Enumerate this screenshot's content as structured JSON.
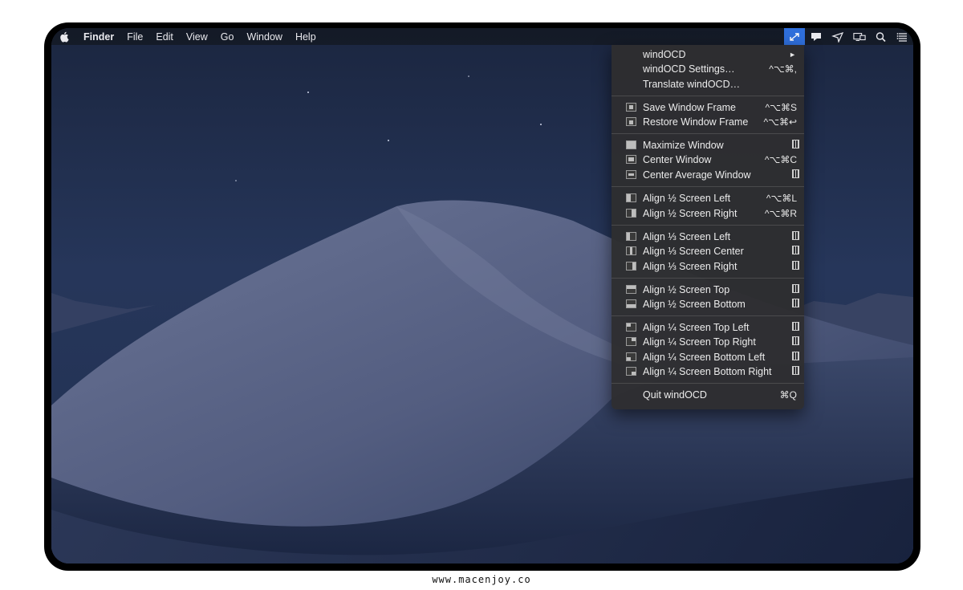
{
  "menubar": {
    "app_name": "Finder",
    "items": [
      "File",
      "Edit",
      "View",
      "Go",
      "Window",
      "Help"
    ],
    "status_icons": [
      "windocd-icon",
      "notification-icon",
      "send-icon",
      "display-icon",
      "search-icon",
      "list-icon"
    ]
  },
  "dropdown": {
    "items": [
      {
        "label": "windOCD",
        "shortcut": "►"
      },
      {
        "label": "windOCD Settings…",
        "shortcut": "^⌥⌘,"
      },
      {
        "label": "Translate windOCD…",
        "shortcut": ""
      },
      {
        "label": "Save Window Frame",
        "shortcut": "^⌥⌘S"
      },
      {
        "label": "Restore Window Frame",
        "shortcut": "^⌥⌘↩"
      },
      {
        "label": "Maximize Window",
        "shortcut": ""
      },
      {
        "label": "Center Window",
        "shortcut": "^⌥⌘C"
      },
      {
        "label": "Center Average Window",
        "shortcut": ""
      },
      {
        "label": "Align ½ Screen Left",
        "shortcut": "^⌥⌘L"
      },
      {
        "label": "Align ½ Screen Right",
        "shortcut": "^⌥⌘R"
      },
      {
        "label": "Align ⅓ Screen Left",
        "shortcut": ""
      },
      {
        "label": "Align ⅓ Screen Center",
        "shortcut": ""
      },
      {
        "label": "Align ⅓ Screen Right",
        "shortcut": ""
      },
      {
        "label": "Align ½ Screen Top",
        "shortcut": ""
      },
      {
        "label": "Align ½ Screen Bottom",
        "shortcut": ""
      },
      {
        "label": "Align ¼ Screen Top Left",
        "shortcut": ""
      },
      {
        "label": "Align ¼ Screen Top Right",
        "shortcut": ""
      },
      {
        "label": "Align ¼ Screen Bottom Left",
        "shortcut": ""
      },
      {
        "label": "Align ¼ Screen Bottom Right",
        "shortcut": ""
      },
      {
        "label": "Quit windOCD",
        "shortcut": "⌘Q"
      }
    ]
  },
  "footer": {
    "text": "www.macenjoy.co"
  },
  "colors": {
    "accent": "#2f6fdc",
    "menu_bg": "#2e2e30",
    "wallpaper": "#1e2a47"
  }
}
